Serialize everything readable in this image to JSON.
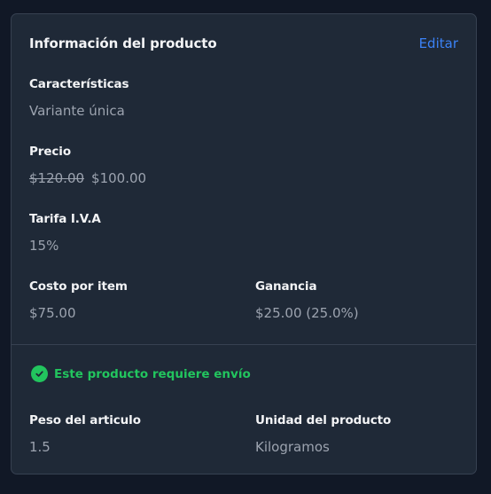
{
  "card": {
    "title": "Información del producto",
    "edit_label": "Editar"
  },
  "fields": {
    "features": {
      "label": "Características",
      "value": "Variante única"
    },
    "price": {
      "label": "Precio",
      "old_value": "$120.00",
      "value": "$100.00"
    },
    "vat": {
      "label": "Tarifa I.V.A",
      "value": "15%"
    },
    "cost": {
      "label": "Costo por item",
      "value": "$75.00"
    },
    "profit": {
      "label": "Ganancia",
      "value": "$25.00 (25.0%)"
    },
    "weight": {
      "label": "Peso del articulo",
      "value": "1.5"
    },
    "unit": {
      "label": "Unidad del producto",
      "value": "Kilogramos"
    }
  },
  "shipping": {
    "text": "Este producto requiere envío",
    "icon": "check-circle-icon",
    "color": "#22c55e"
  },
  "colors": {
    "accent": "#3b82f6",
    "background": "#1f2937"
  }
}
